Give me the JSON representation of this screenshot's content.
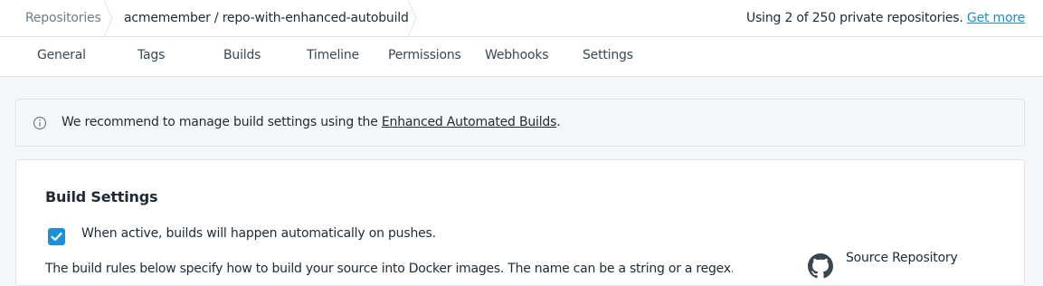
{
  "breadcrumb": {
    "root": "Repositories",
    "current": "acmemember / repo-with-enhanced-autobuild"
  },
  "usage": {
    "text": "Using 2 of 250 private repositories.",
    "link": "Get more"
  },
  "tabs": [
    {
      "label": "General"
    },
    {
      "label": "Tags"
    },
    {
      "label": "Builds"
    },
    {
      "label": "Timeline"
    },
    {
      "label": "Permissions"
    },
    {
      "label": "Webhooks"
    },
    {
      "label": "Settings"
    }
  ],
  "banner": {
    "icon": "info-icon",
    "text": "We recommend to manage build settings using the",
    "link": "Enhanced Automated Builds",
    "suffix": "."
  },
  "build_settings": {
    "title": "Build Settings",
    "autobuild_checked": true,
    "autobuild_label": "When active, builds will happen automatically on pushes.",
    "rules_text": "The build rules below specify how to build your source into Docker images. The name can be a string or a regex. The",
    "source_icon": "github-icon",
    "source_label": "Source Repository"
  },
  "colors": {
    "accent": "#1d8fd6",
    "link": "#1a8fd1"
  }
}
